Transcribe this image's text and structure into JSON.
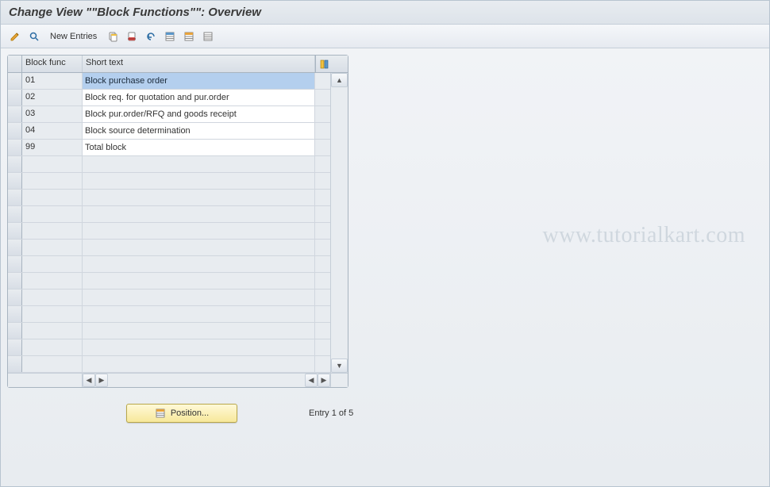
{
  "title": "Change View \"\"Block Functions\"\": Overview",
  "toolbar": {
    "new_entries_label": "New Entries"
  },
  "table": {
    "col_block": "Block func",
    "col_short": "Short text",
    "rows": [
      {
        "block": "01",
        "short": "Block purchase order",
        "selected": true
      },
      {
        "block": "02",
        "short": "Block req. for quotation and pur.order"
      },
      {
        "block": "03",
        "short": "Block pur.order/RFQ and goods receipt"
      },
      {
        "block": "04",
        "short": "Block source determination"
      },
      {
        "block": "99",
        "short": "Total block"
      }
    ],
    "empty_rows": 13
  },
  "footer": {
    "position_label": "Position...",
    "entry_label": "Entry 1 of 5"
  },
  "watermark": "www.tutorialkart.com"
}
